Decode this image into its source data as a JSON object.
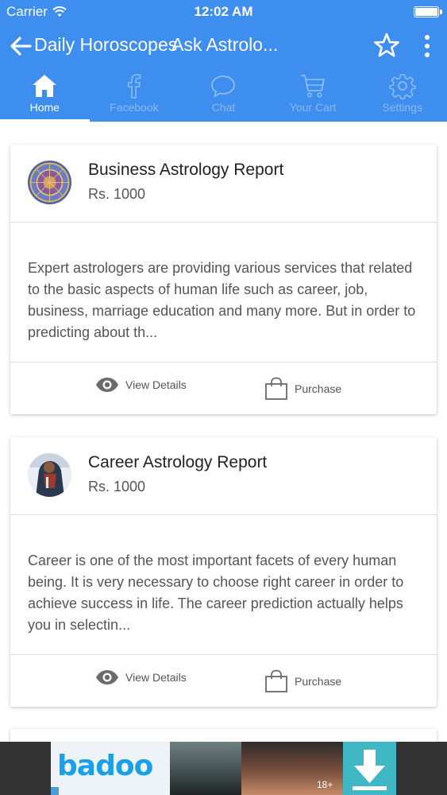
{
  "status_bar": {
    "carrier": "Carrier",
    "time": "12:02 AM"
  },
  "app_bar": {
    "title": "Daily Horoscopes",
    "subtitle": "Ask Astrolo..."
  },
  "tabs": [
    {
      "label": "Home",
      "icon": "home-icon",
      "active": true
    },
    {
      "label": "Facebook",
      "icon": "facebook-icon",
      "active": false
    },
    {
      "label": "Chat",
      "icon": "chat-icon",
      "active": false
    },
    {
      "label": "Your Cart",
      "icon": "cart-icon",
      "active": false
    },
    {
      "label": "Settings",
      "icon": "gear-icon",
      "active": false
    }
  ],
  "cards": [
    {
      "title": "Business Astrology Report",
      "price": "Rs. 1000",
      "description": "Expert astrologers are providing various services that related to the basic aspects of human life such as career, job, business, marriage education and many more. But in order to predicting about th...",
      "view_label": "View Details",
      "purchase_label": "Purchase"
    },
    {
      "title": "Career Astrology Report",
      "price": "Rs. 1000",
      "description": "Career is one of the most important facets of every human being. It is very necessary to choose right career in order to achieve success in life. The career prediction actually helps you in selectin...",
      "view_label": "View Details",
      "purchase_label": "Purchase"
    }
  ],
  "ad": {
    "brand": "badoo",
    "age_badge": "18+"
  },
  "colors": {
    "primary": "#3e8ef0",
    "badoo_blue": "#1aa0e8",
    "download_teal": "#3fb7c4"
  }
}
